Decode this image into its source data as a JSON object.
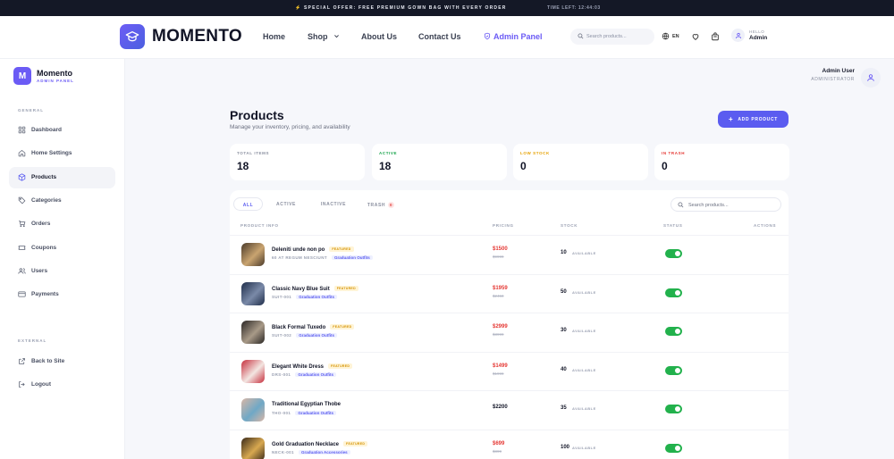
{
  "announcement": {
    "offer": "⚡ SPECIAL OFFER: FREE PREMIUM GOWN BAG WITH EVERY ORDER",
    "timer": "TIME LEFT: 12:44:03"
  },
  "nav": {
    "brand": "MOMENTO",
    "links": [
      "Home",
      "Shop",
      "About Us",
      "Contact Us"
    ],
    "admin_link": "Admin Panel",
    "search_placeholder": "Search products...",
    "lang": "EN",
    "hello": "HELLO",
    "user": "Admin"
  },
  "sidebar": {
    "title": "Momento",
    "subtitle": "ADMIN PANEL",
    "logo_letter": "M",
    "general_label": "GENERAL",
    "external_label": "EXTERNAL",
    "items": [
      {
        "label": "Dashboard",
        "icon": "grid-icon"
      },
      {
        "label": "Home Settings",
        "icon": "home-icon"
      },
      {
        "label": "Products",
        "icon": "box-icon"
      },
      {
        "label": "Categories",
        "icon": "tag-icon"
      },
      {
        "label": "Orders",
        "icon": "cart-icon"
      },
      {
        "label": "Coupons",
        "icon": "ticket-icon"
      },
      {
        "label": "Users",
        "icon": "users-icon"
      },
      {
        "label": "Payments",
        "icon": "card-icon"
      }
    ],
    "external_items": [
      {
        "label": "Back to Site",
        "icon": "external-link-icon"
      },
      {
        "label": "Logout",
        "icon": "logout-icon"
      }
    ]
  },
  "header": {
    "user_name": "Admin User",
    "user_role": "ADMINISTRATOR"
  },
  "page": {
    "title": "Products",
    "subtitle": "Manage your inventory, pricing, and availability",
    "add_button": "ADD PRODUCT"
  },
  "stats": [
    {
      "label": "TOTAL ITEMS",
      "value": "18",
      "color": "#8b90a0"
    },
    {
      "label": "ACTIVE",
      "value": "18",
      "color": "#16a34a"
    },
    {
      "label": "LOW STOCK",
      "value": "0",
      "color": "#e6a100"
    },
    {
      "label": "IN TRASH",
      "value": "0",
      "color": "#e53935"
    }
  ],
  "tabs": [
    {
      "label": "ALL"
    },
    {
      "label": "ACTIVE"
    },
    {
      "label": "INACTIVE"
    },
    {
      "label": "TRASH",
      "badge": "0"
    }
  ],
  "table": {
    "search_placeholder": "Search products...",
    "headers": [
      "PRODUCT INFO",
      "PRICING",
      "STOCK",
      "STATUS",
      "ACTIONS"
    ],
    "stock_label": "AVAILABLE",
    "rows": [
      {
        "name": "Deleniti unde non po",
        "featured": "FEATURED",
        "sku": "60 AT REGUM NESCIUNT",
        "category": "Graduation Outfits",
        "price": "$1500",
        "old_price": "$9999",
        "stock": "10",
        "active": true,
        "thumb": [
          "#4a3a2a",
          "#c9a470"
        ]
      },
      {
        "name": "Classic Navy Blue Suit",
        "featured": "FEATURED",
        "sku": "SUIT-001",
        "category": "Graduation Outfits",
        "price": "$1959",
        "old_price": "$2450",
        "stock": "50",
        "active": true,
        "thumb": [
          "#1f2d4a",
          "#7a8aa8"
        ]
      },
      {
        "name": "Black Formal Tuxedo",
        "featured": "FEATURED",
        "sku": "SUIT-002",
        "category": "Graduation Outfits",
        "price": "$2999",
        "old_price": "$3999",
        "stock": "30",
        "active": true,
        "thumb": [
          "#2a2624",
          "#a89a88"
        ]
      },
      {
        "name": "Elegant White Dress",
        "featured": "FEATURED",
        "sku": "DRS-001",
        "category": "Graduation Outfits",
        "price": "$1499",
        "old_price": "$1999",
        "stock": "40",
        "active": true,
        "thumb": [
          "#c62e3c",
          "#f3e6e2"
        ]
      },
      {
        "name": "Traditional Egyptian Thobe",
        "featured": "",
        "sku": "THO-001",
        "category": "Graduation Outfits",
        "price": "$2200",
        "old_price": "",
        "stock": "35",
        "active": true,
        "thumb": [
          "#d8b6a6",
          "#6fa8c6"
        ]
      },
      {
        "name": "Gold Graduation Necklace",
        "featured": "FEATURED",
        "sku": "NECK-001",
        "category": "Graduation Accessories",
        "price": "$699",
        "old_price": "$899",
        "stock": "100",
        "active": true,
        "thumb": [
          "#3a2a1a",
          "#d8a850"
        ]
      }
    ]
  }
}
